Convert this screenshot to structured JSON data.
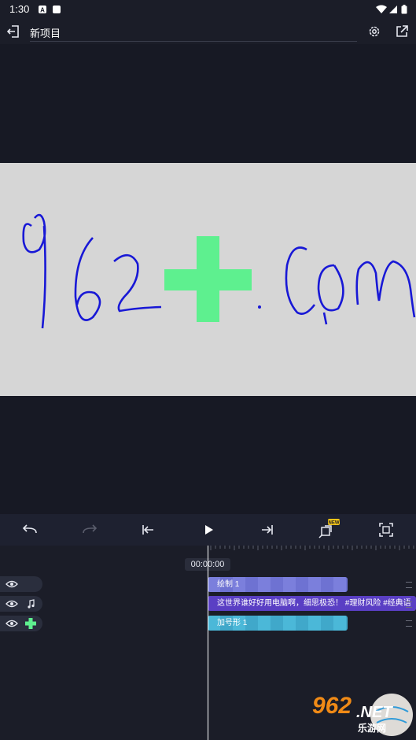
{
  "status_bar": {
    "time": "1:30"
  },
  "app_bar": {
    "title": "新项目"
  },
  "timeline": {
    "timecode": "00:00:00",
    "tracks": [
      {
        "clip_label": "绘制 1"
      },
      {
        "clip_label": "这世界谁好好用电脑啊，细思极恐！ #理财风险 #经典语"
      },
      {
        "clip_label": "加号形 1"
      }
    ]
  },
  "canvas": {
    "handwriting": "962+.com"
  },
  "watermark": {
    "logo_text": "962",
    "logo_domain": ".NET",
    "logo_sub": "乐游网"
  },
  "colors": {
    "accent_green": "#5ef08f",
    "ink_blue": "#1818d6",
    "new_badge": "#f5c518"
  }
}
